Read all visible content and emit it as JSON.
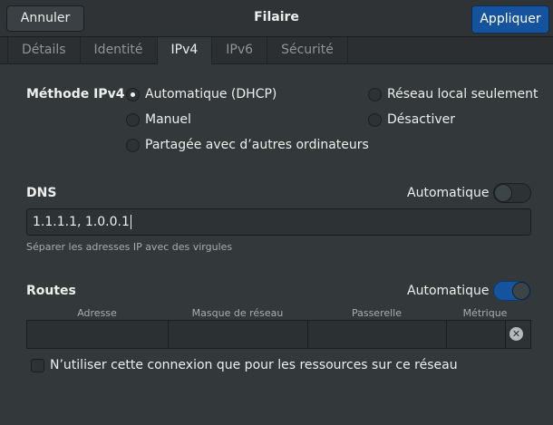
{
  "header": {
    "cancel_label": "Annuler",
    "title": "Filaire",
    "apply_label": "Appliquer"
  },
  "tabs": [
    {
      "label": "Détails",
      "active": false
    },
    {
      "label": "Identité",
      "active": false
    },
    {
      "label": "IPv4",
      "active": true
    },
    {
      "label": "IPv6",
      "active": false
    },
    {
      "label": "Sécurité",
      "active": false
    }
  ],
  "ipv4": {
    "method_label": "Méthode IPv4",
    "methods": [
      {
        "label": "Automatique (DHCP)",
        "selected": true
      },
      {
        "label": "Manuel",
        "selected": false
      },
      {
        "label": "Partagée avec d’autres ordinateurs",
        "selected": false
      },
      {
        "label": "Réseau local seulement",
        "selected": false
      },
      {
        "label": "Désactiver",
        "selected": false
      }
    ]
  },
  "dns": {
    "label": "DNS",
    "auto_label": "Automatique",
    "auto_enabled": false,
    "value": "1.1.1.1, 1.0.0.1",
    "hint": "Séparer les adresses IP avec des virgules"
  },
  "routes": {
    "label": "Routes",
    "auto_label": "Automatique",
    "auto_enabled": true,
    "columns": [
      "Adresse",
      "Masque de réseau",
      "Passerelle",
      "Métrique"
    ],
    "clear_icon": "clear-icon"
  },
  "only_resources": {
    "label": "N’utiliser cette connexion que pour les ressources sur ce réseau",
    "checked": false
  },
  "colors": {
    "accent": "#15539e",
    "background": "#33393b"
  }
}
